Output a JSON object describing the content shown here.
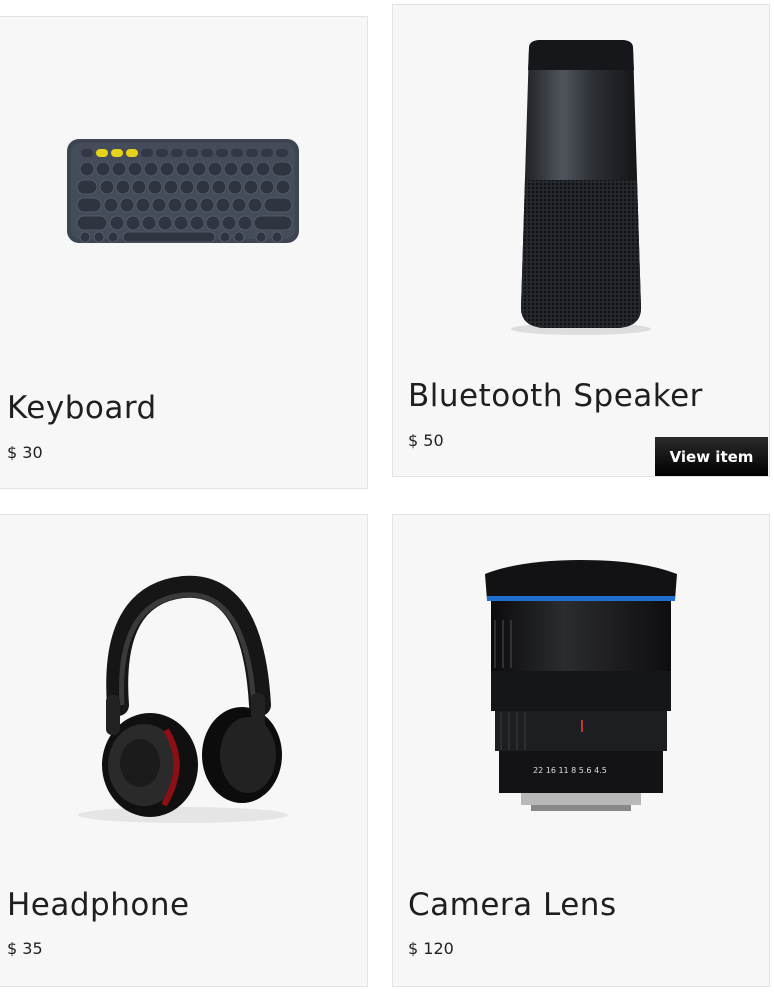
{
  "products": [
    {
      "name": "Keyboard",
      "price": "$ 30",
      "image_icon": "keyboard-icon"
    },
    {
      "name": "Bluetooth Speaker",
      "price": "$ 50",
      "image_icon": "speaker-icon",
      "action_label": "View item"
    },
    {
      "name": "Headphone",
      "price": "$ 35",
      "image_icon": "headphone-icon"
    },
    {
      "name": "Camera Lens",
      "price": "$ 120",
      "image_icon": "camera-lens-icon"
    }
  ],
  "colors": {
    "card_bg": "#f7f7f7",
    "button_bg": "#000000",
    "button_text": "#ffffff",
    "lens_ring": "#1e6fd0",
    "keyboard_accent": "#e7d21a"
  }
}
